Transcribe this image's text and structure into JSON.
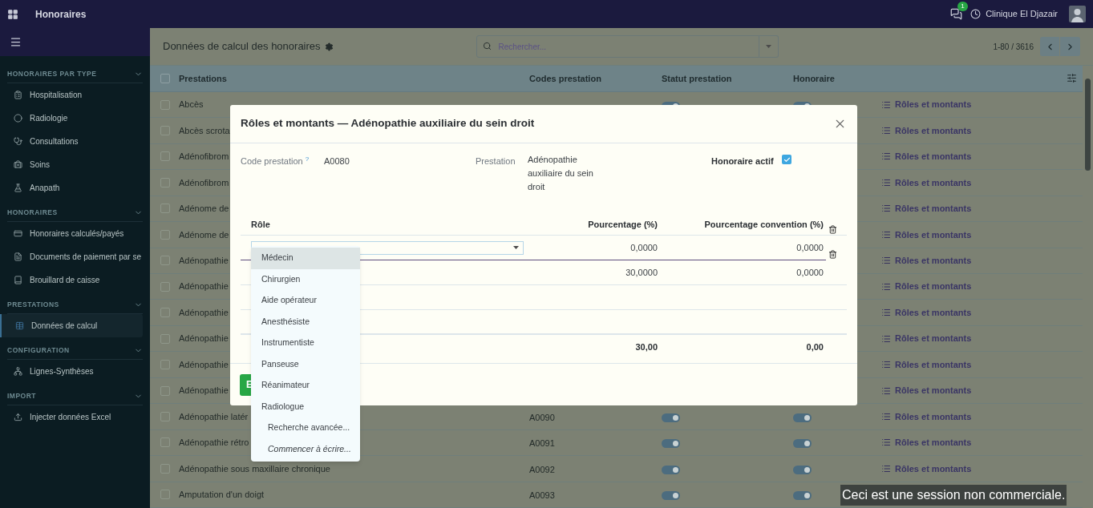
{
  "app_bar": {
    "app_name": "Honoraires",
    "chat_badge": "1",
    "company": "Clinique El Djazair"
  },
  "sidebar": {
    "sections": [
      {
        "title": "HONORAIRES PAR TYPE",
        "expanded": true,
        "items": [
          {
            "label": "Hospitalisation",
            "selected": false
          },
          {
            "label": "Radiologie",
            "selected": false
          },
          {
            "label": "Consultations",
            "selected": false
          },
          {
            "label": "Soins",
            "selected": false
          },
          {
            "label": "Anapath",
            "selected": false
          }
        ]
      },
      {
        "title": "HONORAIRES",
        "expanded": true,
        "items": [
          {
            "label": "Honoraires calculés/payés",
            "selected": false
          },
          {
            "label": "Documents de paiement par se",
            "selected": false
          },
          {
            "label": "Brouillard de caisse",
            "selected": false
          }
        ]
      },
      {
        "title": "PRESTATIONS",
        "expanded": true,
        "items": [
          {
            "label": "Données de calcul",
            "selected": true
          }
        ]
      },
      {
        "title": "CONFIGURATION",
        "expanded": true,
        "items": [
          {
            "label": "Lignes-Synthèses",
            "selected": false
          }
        ]
      },
      {
        "title": "IMPORT",
        "expanded": true,
        "items": [
          {
            "label": "Injecter données Excel",
            "selected": false
          }
        ]
      }
    ]
  },
  "control_panel": {
    "title": "Données de calcul des honoraires",
    "search": {
      "placeholder": "Rechercher..."
    },
    "pager": "1-80 / 3616"
  },
  "table": {
    "select_all_checked": false,
    "columns": [
      "Prestations",
      "Codes prestation",
      "Statut prestation",
      "Honoraire"
    ],
    "rows": [
      {
        "checked": false,
        "name": "Abcès",
        "status_on": true,
        "honoraire_on": true,
        "action": "Rôles et montants"
      },
      {
        "checked": false,
        "name": "Abcès scrota",
        "action": "Rôles et montants"
      },
      {
        "checked": false,
        "name": "Adénofibrom",
        "action": "Rôles et montants"
      },
      {
        "checked": false,
        "name": "Adénofibrom",
        "action": "Rôles et montants"
      },
      {
        "checked": false,
        "name": "Adénome de",
        "action": "Rôles et montants"
      },
      {
        "checked": false,
        "name": "Adénome de",
        "action": "Rôles et montants"
      },
      {
        "checked": false,
        "name": "Adénopathie",
        "action": "Rôles et montants"
      },
      {
        "checked": false,
        "name": "Adénopathie",
        "action": "Rôles et montants"
      },
      {
        "checked": false,
        "name": "Adénopathie",
        "action": "Rôles et montants"
      },
      {
        "checked": false,
        "name": "Adénopathie",
        "action": "Rôles et montants"
      },
      {
        "checked": false,
        "name": "Adénopathie",
        "action": "Rôles et montants"
      },
      {
        "checked": false,
        "name": "Adénopathie",
        "action": "Rôles et montants"
      },
      {
        "checked": false,
        "name": "Adénopathie latér",
        "code": "A0090",
        "status_on": true,
        "honoraire_on": true,
        "action": "Rôles et montants"
      },
      {
        "checked": false,
        "name": "Adénopathie rétro",
        "code": "A0091",
        "status_on": true,
        "honoraire_on": true,
        "action": "Rôles et montants"
      },
      {
        "checked": false,
        "name": "Adénopathie sous maxillaire chronique",
        "code": "A0092",
        "status_on": true,
        "honoraire_on": true,
        "action": "Rôles et montants"
      },
      {
        "checked": false,
        "name": "Amputation d'un doigt",
        "code": "A0093",
        "status_on": true,
        "honoraire_on": true
      }
    ]
  },
  "dialog": {
    "title": "Rôles et montants — Adénopathie auxiliaire du sein droit",
    "fields": {
      "code_label": "Code prestation",
      "help_mark": "?",
      "code_value": "A0080",
      "prestation_label": "Prestation",
      "prestation_value": "Adénopathie auxiliaire du sein droit",
      "active_label": "Honoraire actif",
      "active_checked": true
    },
    "lines": {
      "columns": [
        "Rôle",
        "Pourcentage (%)",
        "Pourcentage convention (%)"
      ],
      "rows": [
        {
          "editing": true,
          "percent": "0,0000",
          "convention": "0,0000"
        },
        {
          "editing": false,
          "percent": "30,0000",
          "convention": "0,0000"
        }
      ],
      "totals": {
        "percent": "30,00",
        "convention": "0,00"
      }
    },
    "save_button": "E",
    "role_dropdown": {
      "options": [
        {
          "kind": "option",
          "label": "Médecin",
          "selected": true
        },
        {
          "kind": "option",
          "label": "Chirurgien",
          "selected": false
        },
        {
          "kind": "option",
          "label": "Aide opérateur",
          "selected": false
        },
        {
          "kind": "option",
          "label": "Anesthésiste",
          "selected": false
        },
        {
          "kind": "option",
          "label": "Instrumentiste",
          "selected": false
        },
        {
          "kind": "option",
          "label": "Panseuse",
          "selected": false
        },
        {
          "kind": "option",
          "label": "Réanimateur",
          "selected": false
        },
        {
          "kind": "option",
          "label": "Radiologue",
          "selected": false
        },
        {
          "kind": "action",
          "label": "Recherche avancée..."
        },
        {
          "kind": "hint",
          "label": "Commencer à écrire..."
        }
      ]
    }
  },
  "session_notice": "Ceci est une session non commerciale."
}
